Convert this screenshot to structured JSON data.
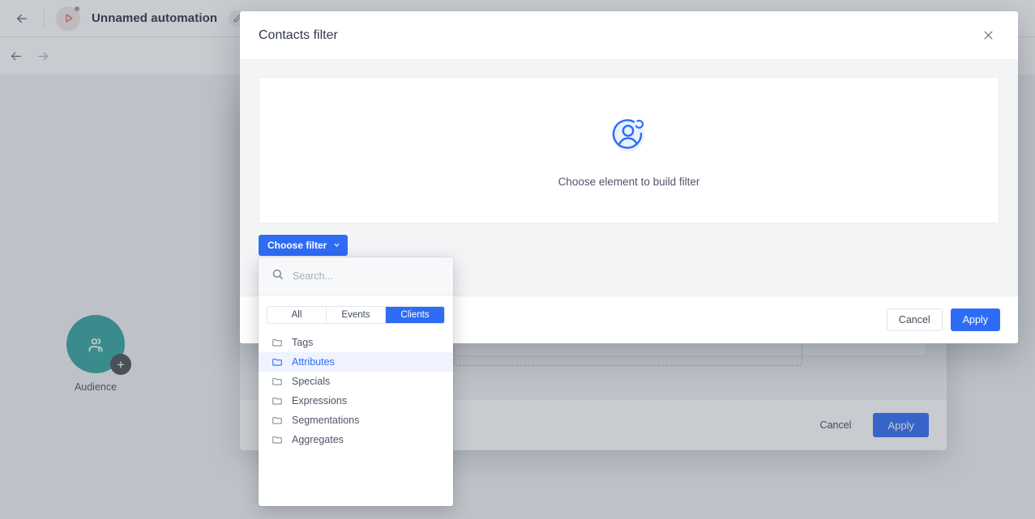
{
  "app": {
    "back_icon": "arrow-left-icon",
    "automation_icon": "play-circle-icon",
    "title": "Unnamed automation",
    "edit_icon": "pencil-icon",
    "tab_icon": "browser-tab-icon",
    "undo_icon": "undo-arrow-icon",
    "redo_icon": "redo-arrow-icon"
  },
  "canvas": {
    "node": {
      "icon": "people-icon",
      "add_icon": "plus-icon",
      "label": "Audience"
    }
  },
  "background_modal": {
    "footer": {
      "cancel_label": "Cancel",
      "apply_label": "Apply"
    }
  },
  "filter_modal": {
    "title": "Contacts filter",
    "close_icon": "close-icon",
    "empty_state": {
      "icon": "contact-avatar-icon",
      "text": "Choose element to build filter"
    },
    "choose_filter": {
      "label": "Choose filter",
      "caret_icon": "chevron-down-icon"
    },
    "footer": {
      "cancel_label": "Cancel",
      "apply_label": "Apply"
    }
  },
  "dropdown": {
    "search": {
      "icon": "search-icon",
      "value": "",
      "placeholder": "Search..."
    },
    "tabs": [
      {
        "label": "All",
        "active": false
      },
      {
        "label": "Events",
        "active": false
      },
      {
        "label": "Clients",
        "active": true
      }
    ],
    "items": [
      {
        "label": "Tags",
        "icon": "folder-icon",
        "highlighted": false
      },
      {
        "label": "Attributes",
        "icon": "folder-icon",
        "highlighted": true
      },
      {
        "label": "Specials",
        "icon": "folder-icon",
        "highlighted": false
      },
      {
        "label": "Expressions",
        "icon": "folder-icon",
        "highlighted": false
      },
      {
        "label": "Segmentations",
        "icon": "folder-icon",
        "highlighted": false
      },
      {
        "label": "Aggregates",
        "icon": "folder-icon",
        "highlighted": false
      }
    ]
  },
  "colors": {
    "accent_blue": "#2f6cf6",
    "node_teal": "#34a4a0",
    "panel_gray": "#f3f4f6",
    "highlight_blue_bg": "#eef3fe"
  }
}
